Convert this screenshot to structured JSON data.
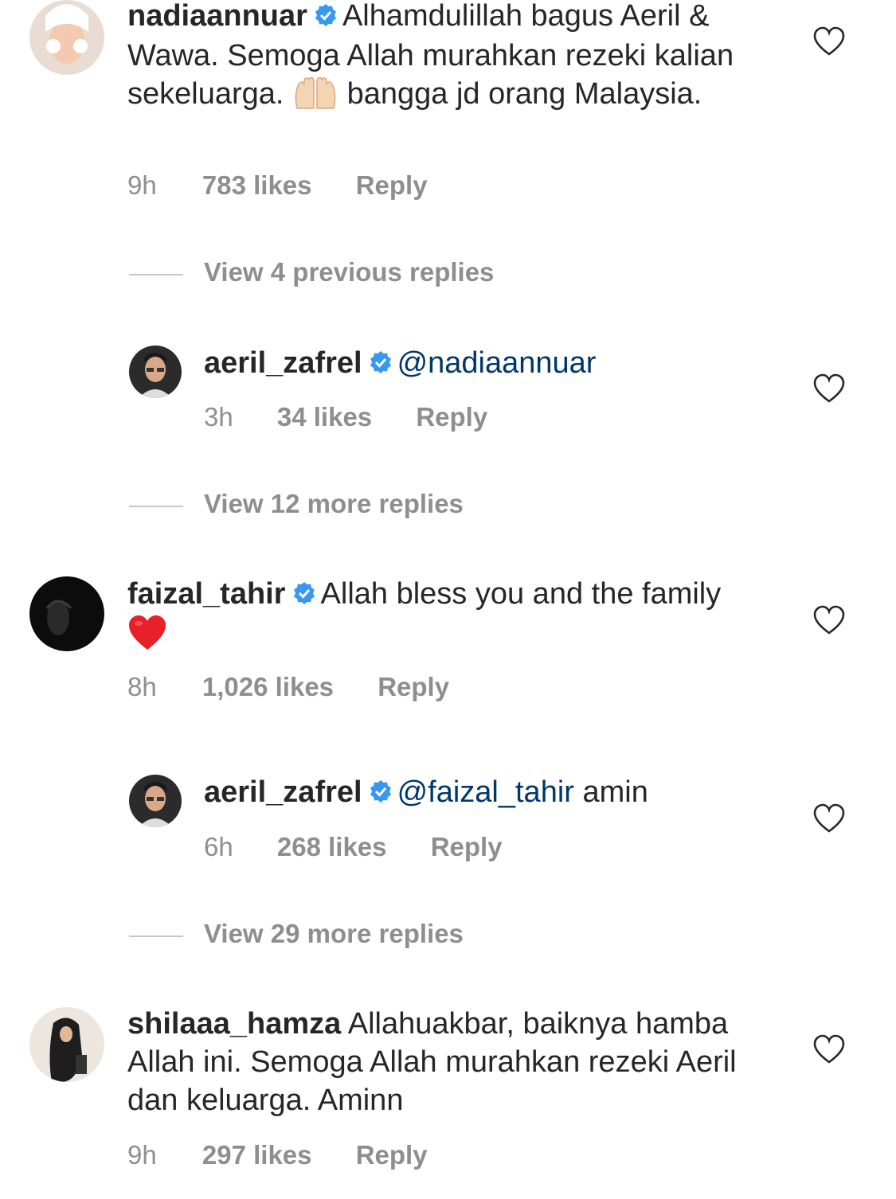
{
  "colors": {
    "text": "#262626",
    "muted": "#8e8e8e",
    "mention": "#00376b",
    "verified": "#3897f0",
    "divider": "#c7c7c7"
  },
  "comments": [
    {
      "username": "nadiaannuar",
      "text_part1": "Alhamdulillah bagus Aeril & Wawa. Semoga Allah murahkan rezeki kalian sekeluarga.",
      "emoji": "raising-hands",
      "text_part2": "bangga jd orang Malaysia.",
      "time": "9h",
      "likes": "783 likes",
      "reply": "Reply"
    },
    {
      "view_replies": "View 4 previous replies"
    },
    {
      "username": "aeril_zafrel",
      "mention": "@nadiaannuar",
      "time": "3h",
      "likes": "34 likes",
      "reply": "Reply"
    },
    {
      "view_replies": "View 12 more replies"
    },
    {
      "username": "faizal_tahir",
      "text_part1": "Allah bless you and the family",
      "emoji": "red-heart",
      "time": "8h",
      "likes": "1,026 likes",
      "reply": "Reply"
    },
    {
      "username": "aeril_zafrel",
      "mention": "@faizal_tahir",
      "text_part1": "amin",
      "time": "6h",
      "likes": "268 likes",
      "reply": "Reply"
    },
    {
      "view_replies": "View 29 more replies"
    },
    {
      "username": "shilaaa_hamza",
      "text_part1": "Allahuakbar, baiknya hamba Allah ini. Semoga Allah murahkan rezeki Aeril dan keluarga. Aminn",
      "time": "9h",
      "likes": "297 likes",
      "reply": "Reply"
    }
  ]
}
